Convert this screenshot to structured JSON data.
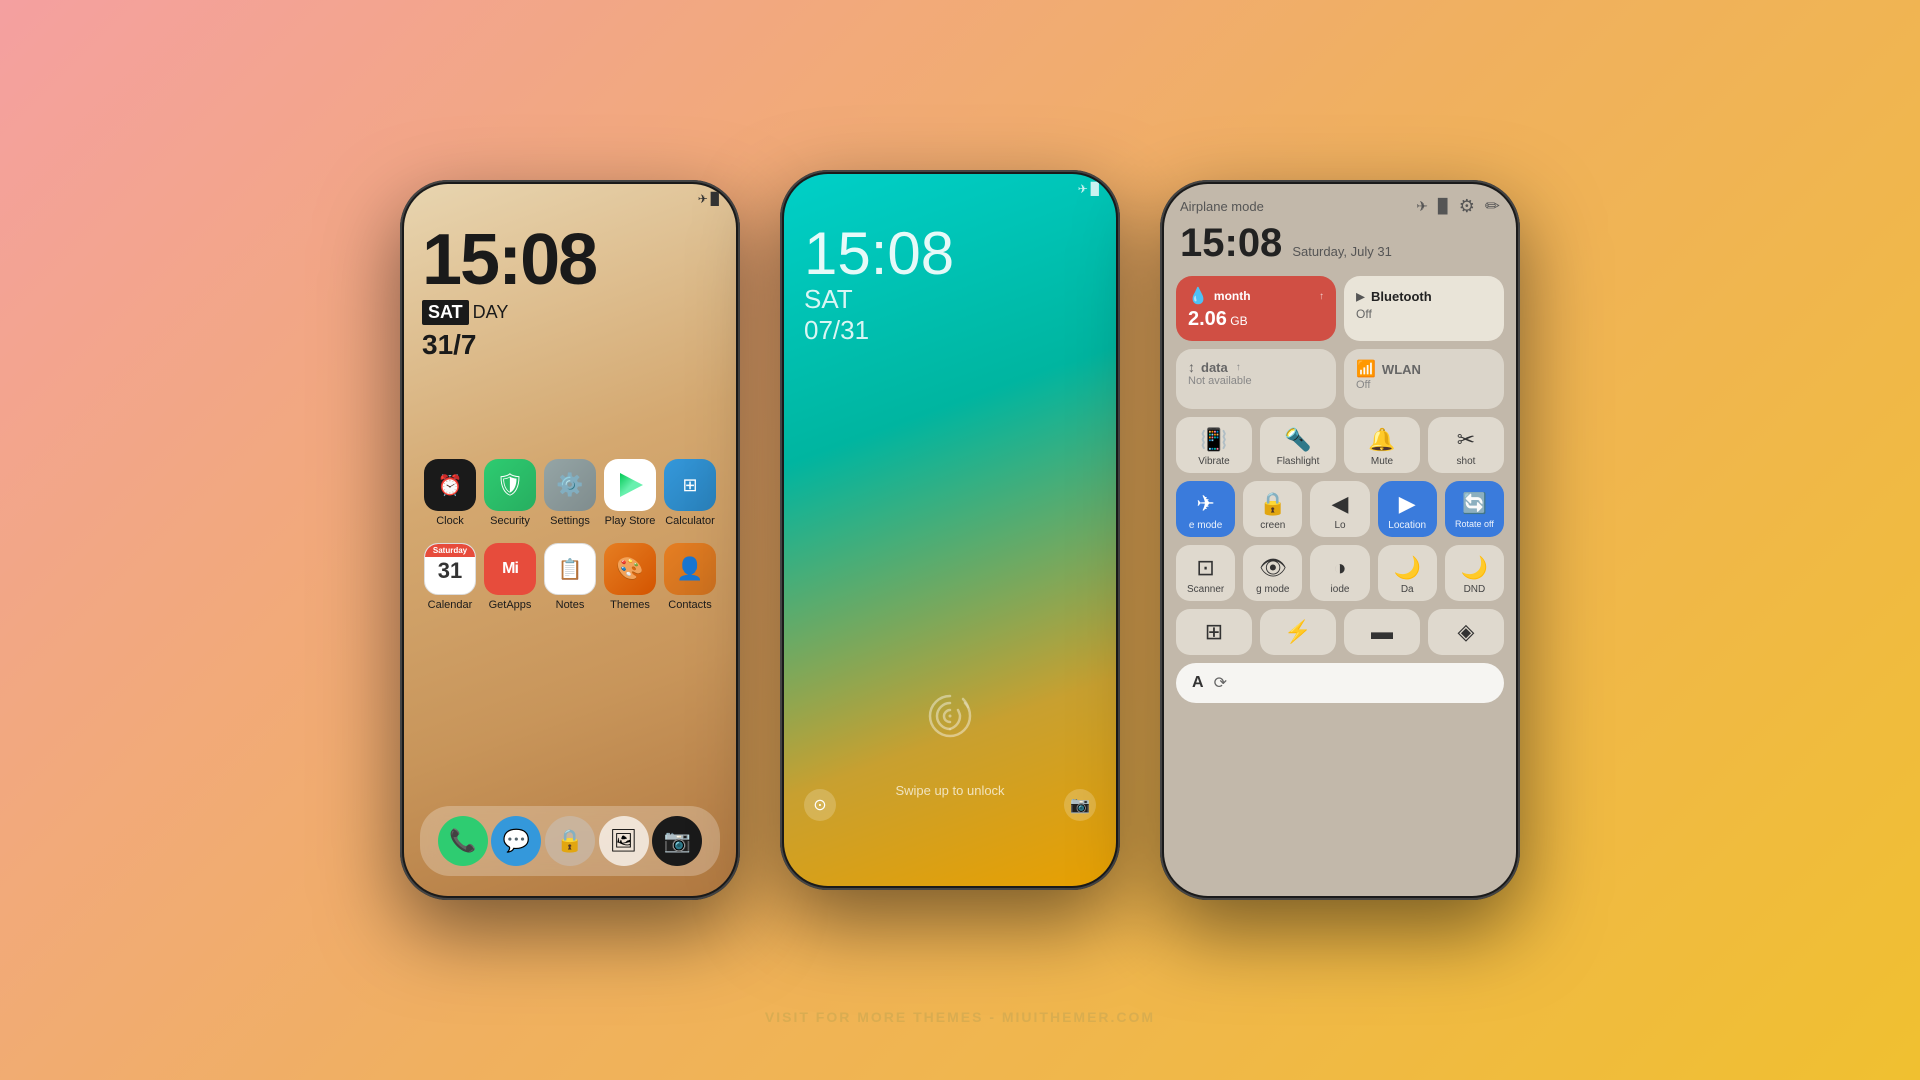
{
  "background": {
    "gradient": "pink-orange-yellow"
  },
  "watermark": "VISIT FOR MORE THEMES - MIUITHEMER.COM",
  "phone1": {
    "type": "homescreen",
    "status_bar": {
      "airplane_icon": "✈",
      "battery_icon": "🔋"
    },
    "clock": {
      "time": "15:08",
      "day_prefix": "SAT",
      "day_suffix": "DAY",
      "date": "31/7"
    },
    "apps_row1": [
      {
        "label": "Clock",
        "color": "#1a1a1a",
        "icon": "⏰"
      },
      {
        "label": "Security",
        "color": "#27ae60",
        "icon": "🛡"
      },
      {
        "label": "Settings",
        "color": "#7f8c8d",
        "icon": "⚙"
      },
      {
        "label": "Play Store",
        "color": "white",
        "icon": "▶"
      },
      {
        "label": "Calculator",
        "color": "#2980b9",
        "icon": "⊞"
      }
    ],
    "apps_row2": [
      {
        "label": "Calendar",
        "icon": "cal",
        "day": "Saturday",
        "num": "31"
      },
      {
        "label": "GetApps",
        "color": "#e74c3c",
        "icon": "Mi"
      },
      {
        "label": "Notes",
        "icon": "notes"
      },
      {
        "label": "Themes",
        "color": "#d35400",
        "icon": "🎨"
      },
      {
        "label": "Contacts",
        "color": "#ca6f1e",
        "icon": "👤"
      }
    ],
    "dock": [
      {
        "label": "Phone",
        "color": "#2ecc71",
        "icon": "📞"
      },
      {
        "label": "Messages",
        "color": "#3498db",
        "icon": "💬"
      },
      {
        "label": "Lock",
        "color": "rgba(255,255,255,0.6)",
        "icon": "🔒"
      },
      {
        "label": "Gallery",
        "color": "white",
        "icon": "🖼"
      },
      {
        "label": "Camera",
        "color": "#1a1a1a",
        "icon": "📷"
      }
    ]
  },
  "phone2": {
    "type": "lockscreen",
    "status": {
      "airplane": "✈",
      "battery": "🔋"
    },
    "time": "15:08",
    "day": "SAT",
    "month_day": "07/31",
    "fingerprint_hint": "",
    "swipe_text": "Swipe up to unlock"
  },
  "phone3": {
    "type": "control_center",
    "header": {
      "mode_label": "Airplane mode",
      "airplane_icon": "✈",
      "battery_icon": "🔋",
      "settings_icon": "⚙",
      "edit_icon": "✏"
    },
    "time": "15:08",
    "date": "Saturday, July 31",
    "tiles_row1": [
      {
        "id": "data-tile",
        "active": true,
        "icon": "💧",
        "title": "month",
        "value": "2.06",
        "unit": "GB"
      },
      {
        "id": "bluetooth-tile",
        "active": false,
        "icon": "🦷",
        "title": "Bluetooth",
        "subtitle": "Off"
      }
    ],
    "tiles_row2": [
      {
        "id": "data2-tile",
        "active": false,
        "icon": "↕",
        "title": "data",
        "subtitle": "Not available"
      },
      {
        "id": "wlan-tile",
        "active": false,
        "icon": "📶",
        "title": "WLAN",
        "subtitle": "Off"
      }
    ],
    "icon_row1": [
      {
        "id": "vibrate",
        "icon": "📳",
        "label": "Vibrate",
        "active": false
      },
      {
        "id": "flashlight",
        "icon": "🔦",
        "label": "Flashlight",
        "active": false
      },
      {
        "id": "mute",
        "icon": "🔔",
        "label": "Mute",
        "active": false
      },
      {
        "id": "screenshot",
        "icon": "✂",
        "label": "shot",
        "active": false
      }
    ],
    "icon_row2": [
      {
        "id": "airplane-mode",
        "icon": "✈",
        "label": "e mode",
        "active": true
      },
      {
        "id": "screen-lock",
        "icon": "🔒",
        "label": "creen",
        "active": false
      },
      {
        "id": "location2",
        "icon": "◀",
        "label": "Lo",
        "active": false
      },
      {
        "id": "location-full",
        "icon": "▶",
        "label": "Location",
        "active": true
      },
      {
        "id": "rotate-off",
        "icon": "🔄",
        "label": "Rotate off",
        "active": true
      }
    ],
    "icon_row3": [
      {
        "id": "scanner",
        "icon": "⊡",
        "label": "Scanner",
        "active": false
      },
      {
        "id": "reading-mode",
        "icon": "👁",
        "label": "g mode",
        "active": false
      },
      {
        "id": "dark-mode",
        "icon": "◑",
        "label": "iode",
        "active": false
      },
      {
        "id": "da",
        "icon": "🌙",
        "label": "Da",
        "active": false
      },
      {
        "id": "dnd",
        "icon": "🌙",
        "label": "DND",
        "active": false
      }
    ],
    "icon_row4": [
      {
        "id": "screen-rec",
        "icon": "⊞",
        "label": "",
        "active": false
      },
      {
        "id": "power",
        "icon": "⚡",
        "label": "",
        "active": false
      },
      {
        "id": "screen2",
        "icon": "▬",
        "label": "",
        "active": false
      },
      {
        "id": "dev",
        "icon": "◈",
        "label": "",
        "active": false
      }
    ],
    "search": {
      "icon": "A",
      "placeholder": ""
    }
  }
}
